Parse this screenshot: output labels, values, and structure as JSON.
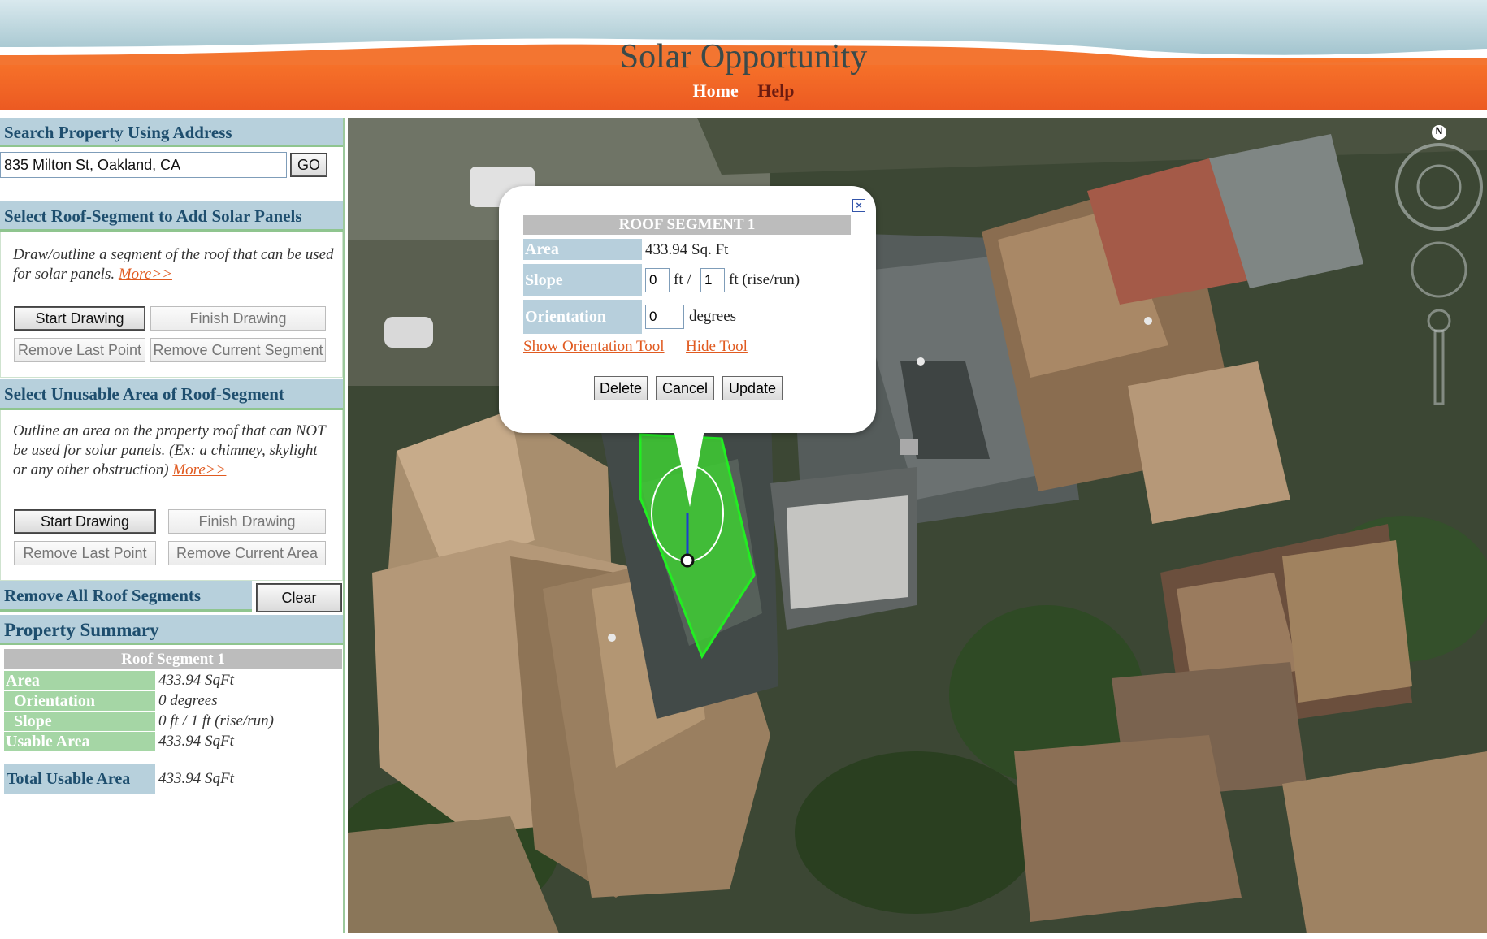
{
  "header": {
    "title": "Solar Opportunity",
    "nav_home": "Home",
    "nav_help": "Help"
  },
  "search": {
    "heading": "Search Property Using Address",
    "address_value": "835 Milton St, Oakland, CA",
    "go_label": "GO"
  },
  "add_segment": {
    "heading": "Select Roof-Segment to Add Solar Panels",
    "description": "Draw/outline a segment of the roof that can be used for solar panels.",
    "more_link": "More>>",
    "start_label": "Start Drawing",
    "finish_label": "Finish Drawing",
    "remove_last_label": "Remove Last Point",
    "remove_current_label": "Remove Current Segment"
  },
  "unusable_area": {
    "heading": "Select Unusable Area of Roof-Segment",
    "description": "Outline an area on the property roof that can NOT be used for solar panels. (Ex: a chimney, skylight or any other obstruction)",
    "more_link": "More>>",
    "start_label": "Start Drawing",
    "finish_label": "Finish Drawing",
    "remove_last_label": "Remove Last Point",
    "remove_current_label": "Remove Current Area"
  },
  "remove_all": {
    "label": "Remove All Roof Segments",
    "clear_label": "Clear"
  },
  "summary": {
    "heading": "Property Summary",
    "segment_title": "Roof Segment 1",
    "rows": [
      {
        "label": "Area",
        "value": "433.94 SqFt"
      },
      {
        "label": "Orientation",
        "value": "0 degrees"
      },
      {
        "label": "Slope",
        "value": "0 ft / 1 ft (rise/run)"
      },
      {
        "label": "Usable Area",
        "value": "433.94 SqFt"
      }
    ],
    "total_label": "Total Usable Area",
    "total_value": "433.94 SqFt"
  },
  "popup": {
    "title": "ROOF SEGMENT 1",
    "area_label": "Area",
    "area_value": "433.94 Sq. Ft",
    "slope_label": "Slope",
    "slope_rise": "0",
    "slope_ft1": "ft /",
    "slope_run": "1",
    "slope_ft2": "ft (rise/run)",
    "orientation_label": "Orientation",
    "orientation_value": "0",
    "orientation_unit": "degrees",
    "show_tool_link": "Show Orientation Tool",
    "hide_tool_link": "Hide Tool",
    "delete_label": "Delete",
    "cancel_label": "Cancel",
    "update_label": "Update",
    "close_icon": "close-icon"
  },
  "map": {
    "compass_label": "N"
  },
  "colors": {
    "header_orange": "#f0642a",
    "header_sky": "#b8d4dc",
    "section_head": "#b7d0dc",
    "summary_label": "#a5d6a5",
    "segment_fill": "#3dcc33",
    "link": "#e05a20"
  }
}
